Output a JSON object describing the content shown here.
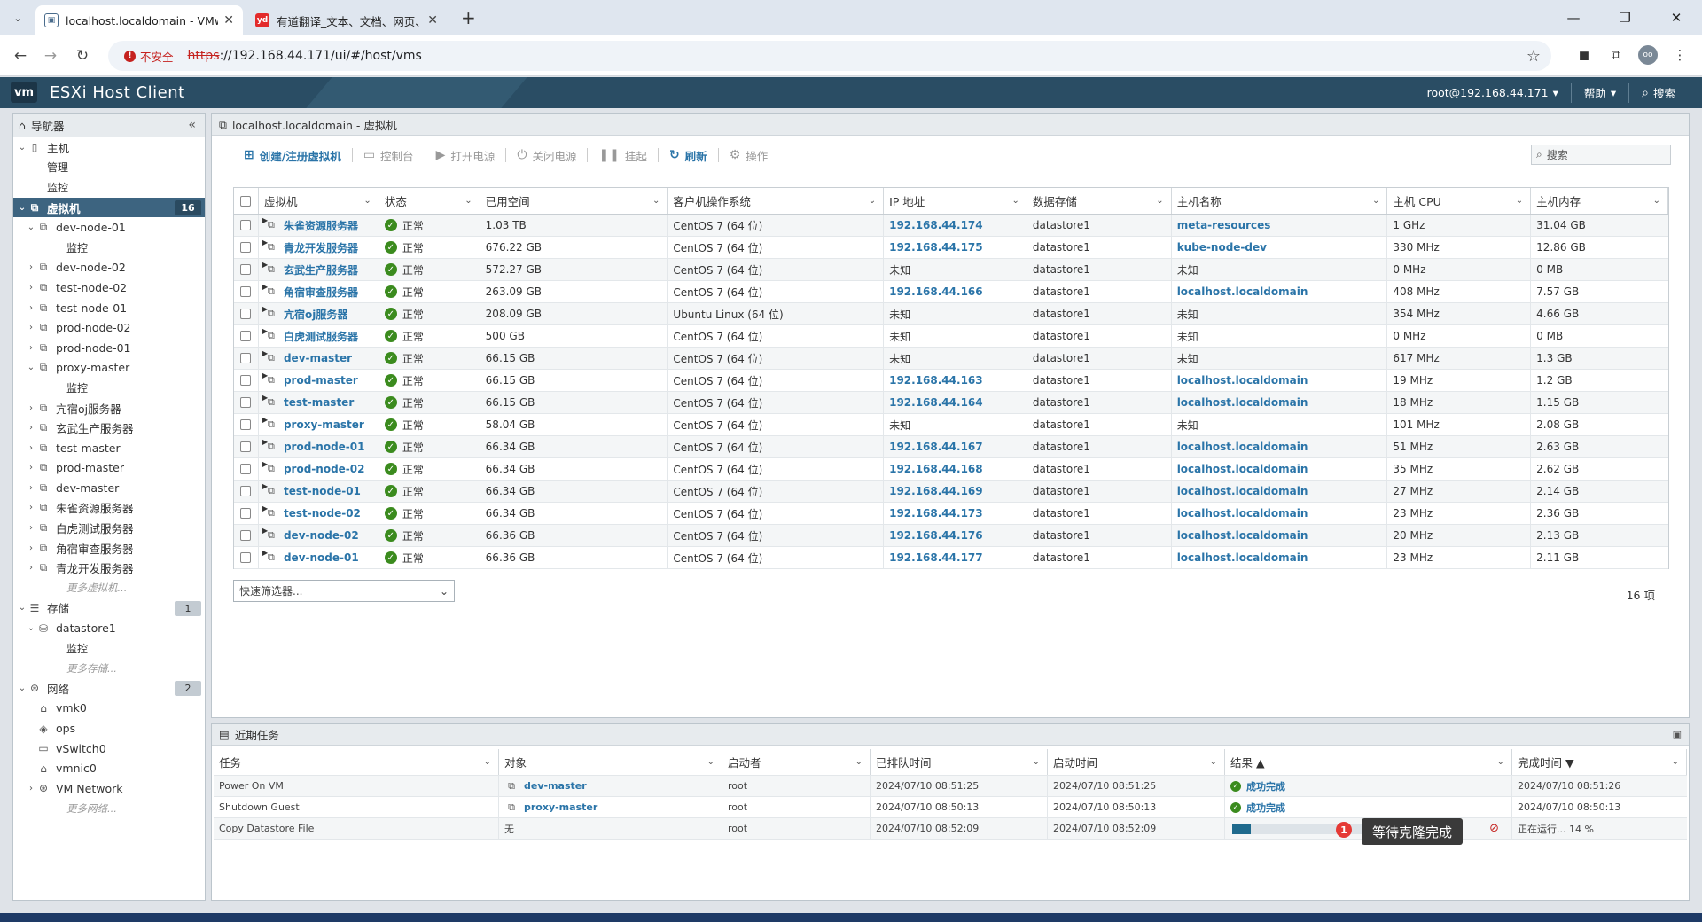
{
  "browser": {
    "tabs": [
      {
        "title": "localhost.localdomain - VMware ESXi",
        "active": true
      },
      {
        "title": "有道翻译_文本、文档、网页、空",
        "active": false
      }
    ],
    "insecure_label": "不安全",
    "url_scheme": "https",
    "url_rest": "://192.168.44.171/ui/#/host/vms",
    "profile_initials": "oo"
  },
  "header": {
    "logo": "vm",
    "title": "ESXi Host Client",
    "user": "root@192.168.44.171",
    "help": "帮助",
    "search": "搜索"
  },
  "navigator": {
    "title": "导航器",
    "host_label": "主机",
    "host_children": [
      "管理",
      "监控"
    ],
    "vms_label": "虚拟机",
    "vms_count": "16",
    "vm_tree": [
      {
        "name": "dev-node-01",
        "expanded": true,
        "children": [
          "监控"
        ]
      },
      {
        "name": "dev-node-02"
      },
      {
        "name": "test-node-02"
      },
      {
        "name": "test-node-01"
      },
      {
        "name": "prod-node-02"
      },
      {
        "name": "prod-node-01"
      },
      {
        "name": "proxy-master",
        "expanded": true,
        "children": [
          "监控"
        ]
      },
      {
        "name": "亢宿oj服务器"
      },
      {
        "name": "玄武生产服务器"
      },
      {
        "name": "test-master"
      },
      {
        "name": "prod-master"
      },
      {
        "name": "dev-master"
      },
      {
        "name": "朱雀资源服务器"
      },
      {
        "name": "白虎测试服务器"
      },
      {
        "name": "角宿审查服务器"
      },
      {
        "name": "青龙开发服务器"
      }
    ],
    "more_vms": "更多虚拟机...",
    "storage_label": "存储",
    "storage_count": "1",
    "datastore": "datastore1",
    "datastore_child": "监控",
    "more_storage": "更多存储...",
    "network_label": "网络",
    "network_count": "2",
    "networks": [
      "vmk0",
      "ops",
      "vSwitch0",
      "vmnic0",
      "VM Network"
    ],
    "more_network": "更多网络..."
  },
  "main": {
    "title": "localhost.localdomain - 虚拟机",
    "toolbar": {
      "create": "创建/注册虚拟机",
      "console": "控制台",
      "power_on": "打开电源",
      "power_off": "关闭电源",
      "suspend": "挂起",
      "refresh": "刷新",
      "actions": "操作",
      "search_placeholder": "搜索"
    },
    "columns": [
      "虚拟机",
      "状态",
      "已用空间",
      "客户机操作系统",
      "IP 地址",
      "数据存储",
      "主机名称",
      "主机 CPU",
      "主机内存"
    ],
    "rows": [
      {
        "name": "朱雀资源服务器",
        "state": "正常",
        "space": "1.03 TB",
        "os": "CentOS 7 (64 位)",
        "ip": "192.168.44.174",
        "ds": "datastore1",
        "host": "meta-resources",
        "cpu": "1 GHz",
        "mem": "31.04 GB"
      },
      {
        "name": "青龙开发服务器",
        "state": "正常",
        "space": "676.22 GB",
        "os": "CentOS 7 (64 位)",
        "ip": "192.168.44.175",
        "ds": "datastore1",
        "host": "kube-node-dev",
        "cpu": "330 MHz",
        "mem": "12.86 GB"
      },
      {
        "name": "玄武生产服务器",
        "state": "正常",
        "space": "572.27 GB",
        "os": "CentOS 7 (64 位)",
        "ip": "未知",
        "ds": "datastore1",
        "host": "未知",
        "cpu": "0 MHz",
        "mem": "0 MB"
      },
      {
        "name": "角宿审查服务器",
        "state": "正常",
        "space": "263.09 GB",
        "os": "CentOS 7 (64 位)",
        "ip": "192.168.44.166",
        "ds": "datastore1",
        "host": "localhost.localdomain",
        "cpu": "408 MHz",
        "mem": "7.57 GB"
      },
      {
        "name": "亢宿oj服务器",
        "state": "正常",
        "space": "208.09 GB",
        "os": "Ubuntu Linux (64 位)",
        "ip": "未知",
        "ds": "datastore1",
        "host": "未知",
        "cpu": "354 MHz",
        "mem": "4.66 GB"
      },
      {
        "name": "白虎测试服务器",
        "state": "正常",
        "space": "500 GB",
        "os": "CentOS 7 (64 位)",
        "ip": "未知",
        "ds": "datastore1",
        "host": "未知",
        "cpu": "0 MHz",
        "mem": "0 MB"
      },
      {
        "name": "dev-master",
        "state": "正常",
        "space": "66.15 GB",
        "os": "CentOS 7 (64 位)",
        "ip": "未知",
        "ds": "datastore1",
        "host": "未知",
        "cpu": "617 MHz",
        "mem": "1.3 GB"
      },
      {
        "name": "prod-master",
        "state": "正常",
        "space": "66.15 GB",
        "os": "CentOS 7 (64 位)",
        "ip": "192.168.44.163",
        "ds": "datastore1",
        "host": "localhost.localdomain",
        "cpu": "19 MHz",
        "mem": "1.2 GB"
      },
      {
        "name": "test-master",
        "state": "正常",
        "space": "66.15 GB",
        "os": "CentOS 7 (64 位)",
        "ip": "192.168.44.164",
        "ds": "datastore1",
        "host": "localhost.localdomain",
        "cpu": "18 MHz",
        "mem": "1.15 GB"
      },
      {
        "name": "proxy-master",
        "state": "正常",
        "space": "58.04 GB",
        "os": "CentOS 7 (64 位)",
        "ip": "未知",
        "ds": "datastore1",
        "host": "未知",
        "cpu": "101 MHz",
        "mem": "2.08 GB"
      },
      {
        "name": "prod-node-01",
        "state": "正常",
        "space": "66.34 GB",
        "os": "CentOS 7 (64 位)",
        "ip": "192.168.44.167",
        "ds": "datastore1",
        "host": "localhost.localdomain",
        "cpu": "51 MHz",
        "mem": "2.63 GB"
      },
      {
        "name": "prod-node-02",
        "state": "正常",
        "space": "66.34 GB",
        "os": "CentOS 7 (64 位)",
        "ip": "192.168.44.168",
        "ds": "datastore1",
        "host": "localhost.localdomain",
        "cpu": "35 MHz",
        "mem": "2.62 GB"
      },
      {
        "name": "test-node-01",
        "state": "正常",
        "space": "66.34 GB",
        "os": "CentOS 7 (64 位)",
        "ip": "192.168.44.169",
        "ds": "datastore1",
        "host": "localhost.localdomain",
        "cpu": "27 MHz",
        "mem": "2.14 GB"
      },
      {
        "name": "test-node-02",
        "state": "正常",
        "space": "66.34 GB",
        "os": "CentOS 7 (64 位)",
        "ip": "192.168.44.173",
        "ds": "datastore1",
        "host": "localhost.localdomain",
        "cpu": "23 MHz",
        "mem": "2.36 GB"
      },
      {
        "name": "dev-node-02",
        "state": "正常",
        "space": "66.36 GB",
        "os": "CentOS 7 (64 位)",
        "ip": "192.168.44.176",
        "ds": "datastore1",
        "host": "localhost.localdomain",
        "cpu": "20 MHz",
        "mem": "2.13 GB"
      },
      {
        "name": "dev-node-01",
        "state": "正常",
        "space": "66.36 GB",
        "os": "CentOS 7 (64 位)",
        "ip": "192.168.44.177",
        "ds": "datastore1",
        "host": "localhost.localdomain",
        "cpu": "23 MHz",
        "mem": "2.11 GB"
      }
    ],
    "quick_filter": "快速筛选器...",
    "item_count": "16 项"
  },
  "tasks": {
    "title": "近期任务",
    "columns": [
      "任务",
      "对象",
      "启动者",
      "已排队时间",
      "启动时间",
      "结果 ▲",
      "完成时间 ▼"
    ],
    "rows": [
      {
        "task": "Power On VM",
        "object": "dev-master",
        "by": "root",
        "queued": "2024/07/10 08:51:25",
        "started": "2024/07/10 08:51:25",
        "result": "成功完成",
        "completed": "2024/07/10 08:51:26"
      },
      {
        "task": "Shutdown Guest",
        "object": "proxy-master",
        "by": "root",
        "queued": "2024/07/10 08:50:13",
        "started": "2024/07/10 08:50:13",
        "result": "成功完成",
        "completed": "2024/07/10 08:50:13"
      },
      {
        "task": "Copy Datastore File",
        "object": "无",
        "by": "root",
        "queued": "2024/07/10 08:52:09",
        "started": "2024/07/10 08:52:09",
        "progress": 0.14,
        "completed": "正在运行... 14 %"
      }
    ],
    "badge": "1",
    "tooltip": "等待克隆完成"
  }
}
